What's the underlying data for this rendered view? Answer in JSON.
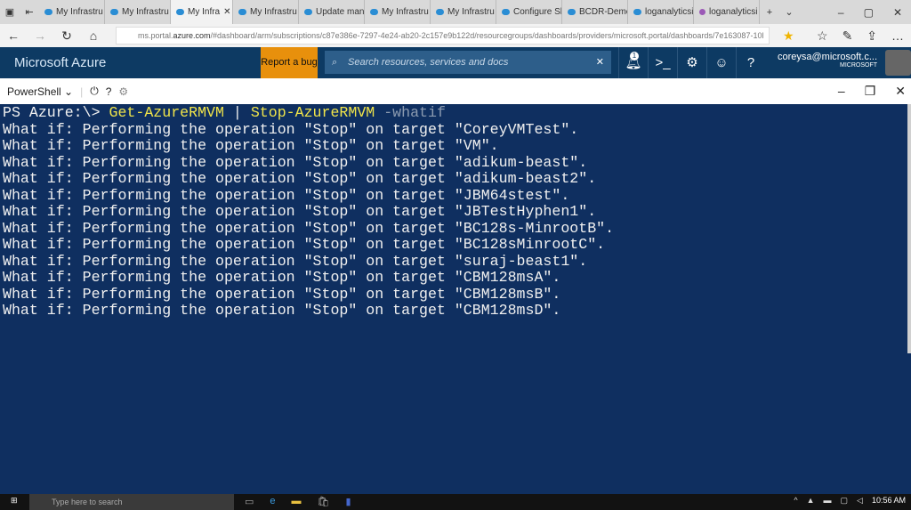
{
  "browser": {
    "tabs": [
      {
        "label": "My Infrastru"
      },
      {
        "label": "My Infrastru"
      },
      {
        "label": "My Infra",
        "active": true
      },
      {
        "label": "My Infrastru"
      },
      {
        "label": "Update man"
      },
      {
        "label": "My Infrastru"
      },
      {
        "label": "My Infrastru"
      },
      {
        "label": "Configure Sl"
      },
      {
        "label": "BCDR-Demc"
      },
      {
        "label": "loganalyticsi"
      },
      {
        "label": "loganalyticsi"
      }
    ],
    "url_prefix": "ms.portal.",
    "url_domain": "azure.com",
    "url_path": "/#dashboard/arm/subscriptions/c87e386e-7297-4e24-ab20-2c157e9b122d/resourcegroups/dashboards/providers/microsoft.portal/dashboards/7e163087-10l"
  },
  "azure": {
    "brand": "Microsoft Azure",
    "report_bug": "Report a bug",
    "search_placeholder": "Search resources, services and docs",
    "notification_count": "1",
    "user_email": "coreysa@microsoft.c...",
    "user_org": "MICROSOFT"
  },
  "shell": {
    "selector": "PowerShell"
  },
  "terminal": {
    "prompt": "PS Azure:\\> ",
    "cmd1": "Get-AzureRMVM",
    "pipe": " | ",
    "cmd2": "Stop-AzureRMVM",
    "param": " -whatif",
    "lines": [
      "What if: Performing the operation \"Stop\" on target \"CoreyVMTest\".",
      "What if: Performing the operation \"Stop\" on target \"VM\".",
      "What if: Performing the operation \"Stop\" on target \"adikum-beast\".",
      "What if: Performing the operation \"Stop\" on target \"adikum-beast2\".",
      "What if: Performing the operation \"Stop\" on target \"JBM64stest\".",
      "What if: Performing the operation \"Stop\" on target \"JBTestHyphen1\".",
      "What if: Performing the operation \"Stop\" on target \"BC128s-MinrootB\".",
      "What if: Performing the operation \"Stop\" on target \"BC128sMinrootC\".",
      "What if: Performing the operation \"Stop\" on target \"suraj-beast1\".",
      "What if: Performing the operation \"Stop\" on target \"CBM128msA\".",
      "What if: Performing the operation \"Stop\" on target \"CBM128msB\".",
      "What if: Performing the operation \"Stop\" on target \"CBM128msD\"."
    ]
  },
  "taskbar": {
    "search_placeholder": "Type here to search",
    "time": "10:56 AM"
  }
}
